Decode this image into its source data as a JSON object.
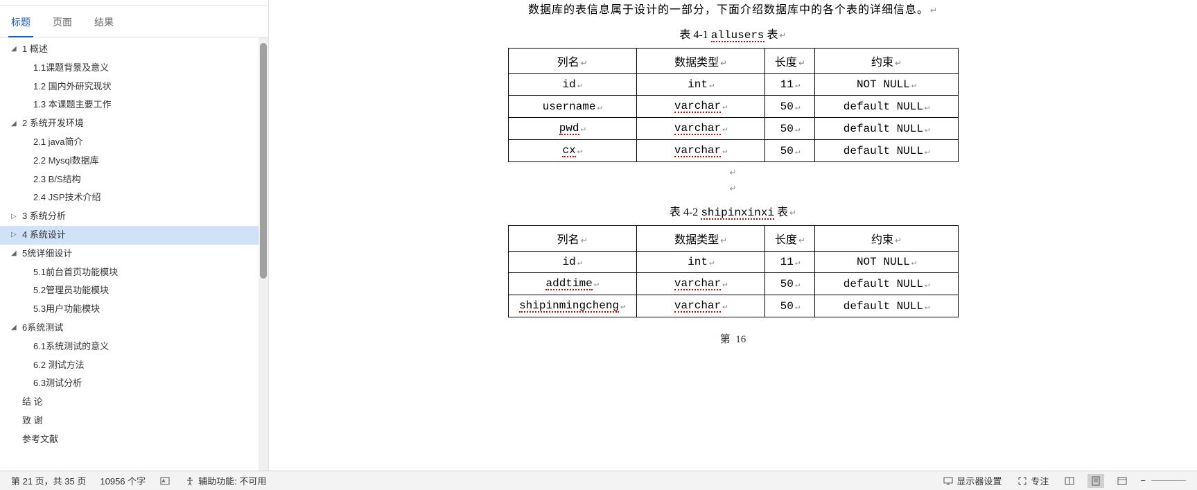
{
  "sidebar": {
    "tabs": [
      {
        "label": "标题",
        "active": true
      },
      {
        "label": "页面",
        "active": false
      },
      {
        "label": "结果",
        "active": false
      }
    ],
    "outline": [
      {
        "label": "1 概述",
        "level": 1,
        "toggle": "▢",
        "expanded": true
      },
      {
        "label": "1.1课题背景及意义",
        "level": 2
      },
      {
        "label": "1.2 国内外研究现状",
        "level": 2
      },
      {
        "label": "1.3 本课题主要工作",
        "level": 2
      },
      {
        "label": "2 系统开发环境",
        "level": 1,
        "toggle": "▢",
        "expanded": true
      },
      {
        "label": "2.1 java简介",
        "level": 2
      },
      {
        "label": "2.2 Mysql数据库",
        "level": 2
      },
      {
        "label": "2.3 B/S结构",
        "level": 2
      },
      {
        "label": "2.4 JSP技术介绍",
        "level": 2
      },
      {
        "label": "3 系统分析",
        "level": 1,
        "toggle": "▷"
      },
      {
        "label": "4 系统设计",
        "level": 1,
        "toggle": "▷",
        "selected": true
      },
      {
        "label": "5统详细设计",
        "level": 1,
        "toggle": "▢",
        "expanded": true
      },
      {
        "label": "5.1前台首页功能模块",
        "level": 2
      },
      {
        "label": "5.2管理员功能模块",
        "level": 2
      },
      {
        "label": "5.3用户功能模块",
        "level": 2
      },
      {
        "label": "6系统测试",
        "level": 1,
        "toggle": "▢",
        "expanded": true
      },
      {
        "label": "6.1系统测试的意义",
        "level": 2
      },
      {
        "label": "6.2 测试方法",
        "level": 2
      },
      {
        "label": "6.3测试分析",
        "level": 2
      },
      {
        "label": "结  论",
        "level": 1
      },
      {
        "label": "致  谢",
        "level": 1
      },
      {
        "label": "参考文献",
        "level": 1
      }
    ]
  },
  "document": {
    "intro": "数据库的表信息属于设计的一部分，下面介绍数据库中的各个表的详细信息。",
    "caption1_prefix": "表 4-1  ",
    "caption1_name": "allusers",
    "caption1_suffix": " 表",
    "caption2_prefix": "表 4-2  ",
    "caption2_name": "shipinxinxi",
    "caption2_suffix": " 表",
    "table_header": {
      "c1": "列名",
      "c2": "数据类型",
      "c3": "长度",
      "c4": "约束"
    },
    "table1": [
      {
        "c1": "id",
        "c2": "int",
        "c3": "11",
        "c4": "NOT NULL"
      },
      {
        "c1": "username",
        "c2": "varchar",
        "c3": "50",
        "c4": "default NULL"
      },
      {
        "c1": "pwd",
        "c2": "varchar",
        "c3": "50",
        "c4": "default NULL"
      },
      {
        "c1": "cx",
        "c2": "varchar",
        "c3": "50",
        "c4": "default NULL"
      }
    ],
    "table2": [
      {
        "c1": "id",
        "c2": "int",
        "c3": "11",
        "c4": "NOT NULL"
      },
      {
        "c1": "addtime",
        "c2": "varchar",
        "c3": "50",
        "c4": "default NULL"
      },
      {
        "c1": "shipinmingcheng",
        "c2": "varchar",
        "c3": "50",
        "c4": "default NULL"
      }
    ],
    "page_num_prefix": "第",
    "page_num": "16"
  },
  "statusbar": {
    "page_info": "第 21 页，共 35 页",
    "word_count": "10956 个字",
    "accessibility": "辅助功能: 不可用",
    "display_settings": "显示器设置",
    "focus": "专注"
  },
  "chart_data": [
    {
      "type": "table",
      "title": "表 4-1 allusers 表",
      "columns": [
        "列名",
        "数据类型",
        "长度",
        "约束"
      ],
      "rows": [
        [
          "id",
          "int",
          "11",
          "NOT NULL"
        ],
        [
          "username",
          "varchar",
          "50",
          "default NULL"
        ],
        [
          "pwd",
          "varchar",
          "50",
          "default NULL"
        ],
        [
          "cx",
          "varchar",
          "50",
          "default NULL"
        ]
      ]
    },
    {
      "type": "table",
      "title": "表 4-2 shipinxinxi 表",
      "columns": [
        "列名",
        "数据类型",
        "长度",
        "约束"
      ],
      "rows": [
        [
          "id",
          "int",
          "11",
          "NOT NULL"
        ],
        [
          "addtime",
          "varchar",
          "50",
          "default NULL"
        ],
        [
          "shipinmingcheng",
          "varchar",
          "50",
          "default NULL"
        ]
      ]
    }
  ]
}
